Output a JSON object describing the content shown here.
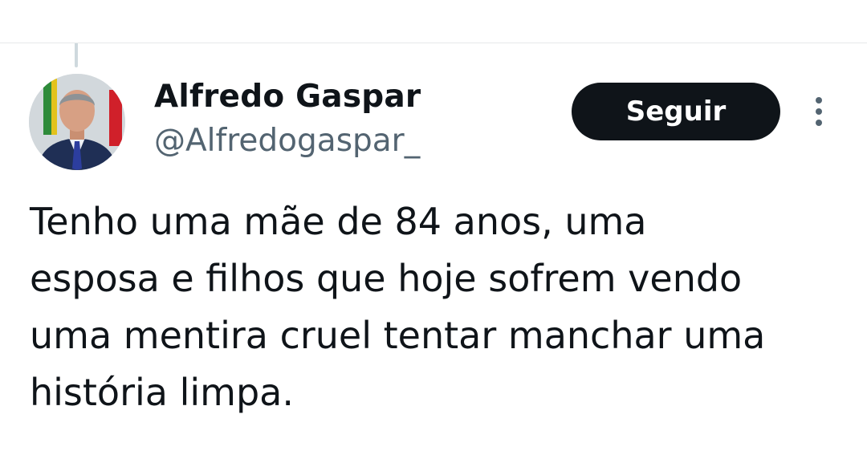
{
  "tweet": {
    "author": {
      "display_name": "Alfredo Gaspar",
      "handle": "@Alfredogaspar_",
      "avatar_icon": "profile-photo"
    },
    "follow_label": "Seguir",
    "more_icon": "vertical-ellipsis-icon",
    "text_lines": [
      "Tenho uma mãe de 84 anos, uma",
      "esposa e filhos que hoje sofrem vendo",
      "uma mentira cruel tentar manchar uma",
      "história limpa."
    ]
  },
  "colors": {
    "text_primary": "#0f1419",
    "text_secondary": "#536471",
    "button_bg": "#0f1419",
    "button_text": "#ffffff",
    "divider": "#e7e9ea"
  }
}
